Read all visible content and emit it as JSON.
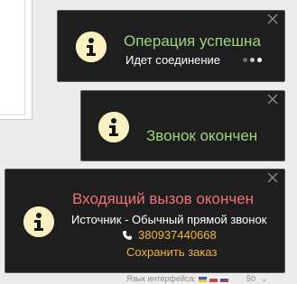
{
  "background": {
    "footer_label": "Язык интерфейса:",
    "footer_number": "50"
  },
  "notifications": [
    {
      "title": "Операция успешна",
      "message": "Идет соединение",
      "icon": "info-icon",
      "close_icon": "close-icon",
      "title_color": "#9fd67a"
    },
    {
      "title": "Звонок окончен",
      "icon": "info-icon",
      "close_icon": "close-icon",
      "title_color": "#9fd67a"
    },
    {
      "title": "Входящий вызов окончен",
      "message": "Источник - Обычный прямой звонок",
      "phone": "380937440668",
      "phone_icon": "phone-icon",
      "action_label": "Сохранить заказ",
      "icon": "info-icon",
      "close_icon": "close-icon",
      "title_color": "#f0717b",
      "link_color": "#f3b53a"
    }
  ]
}
